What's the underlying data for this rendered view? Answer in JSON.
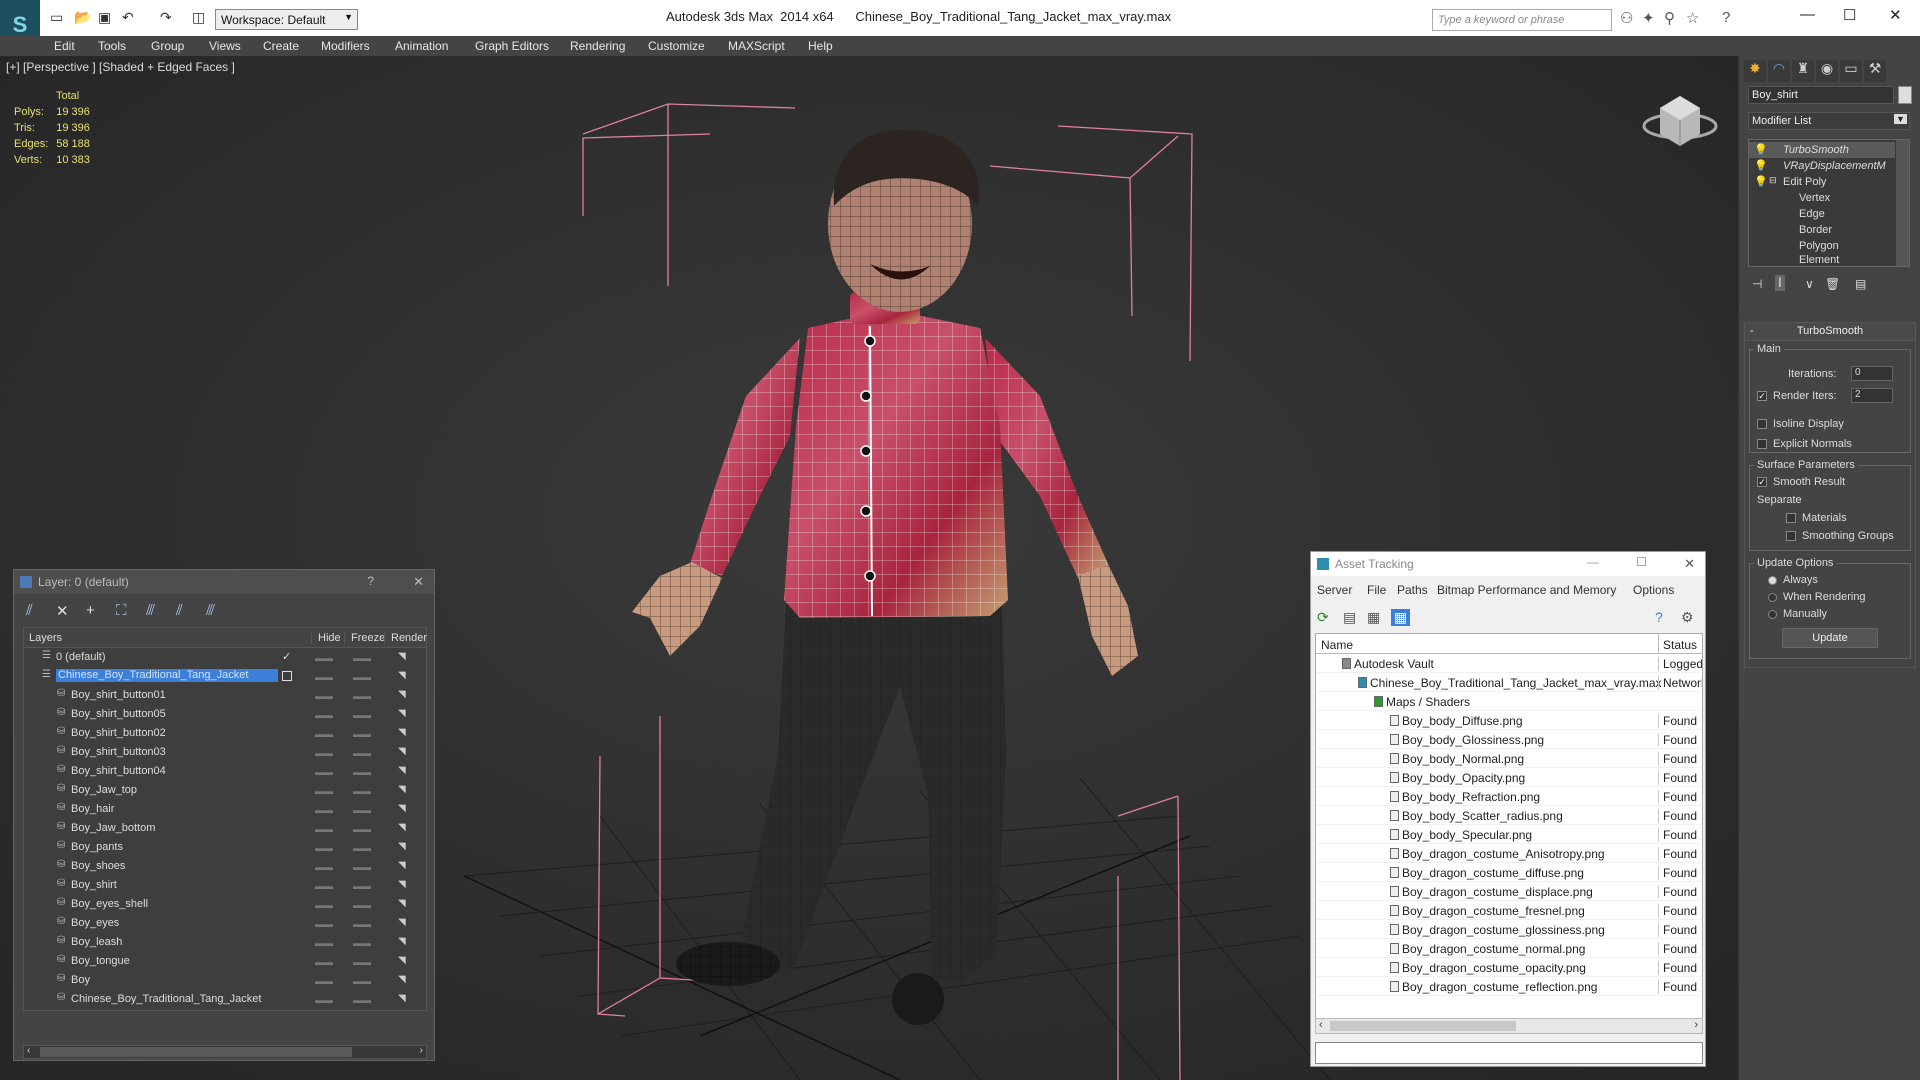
{
  "titlebar": {
    "app": "Autodesk 3ds Max  2014 x64",
    "file": "Chinese_Boy_Traditional_Tang_Jacket_max_vray.max",
    "workspace": "Workspace: Default",
    "search_placeholder": "Type a keyword or phrase"
  },
  "menu": [
    "Edit",
    "Tools",
    "Group",
    "Views",
    "Create",
    "Modifiers",
    "Animation",
    "Graph Editors",
    "Rendering",
    "Customize",
    "MAXScript",
    "Help"
  ],
  "viewport": {
    "label": "[+] [Perspective ] [Shaded + Edged Faces ]",
    "stats": {
      "header": "Total",
      "rows": [
        {
          "k": "Polys:",
          "v": "19 396"
        },
        {
          "k": "Tris:",
          "v": "19 396"
        },
        {
          "k": "Edges:",
          "v": "58 188"
        },
        {
          "k": "Verts:",
          "v": "10 383"
        }
      ]
    }
  },
  "command_panel": {
    "object_name": "Boy_shirt",
    "modifier_list": "Modifier List",
    "stack": [
      "TurboSmooth",
      "VRayDisplacementM",
      "Edit Poly",
      "Vertex",
      "Edge",
      "Border",
      "Polygon",
      "Element"
    ],
    "rollout_title": "TurboSmooth",
    "main_group": "Main",
    "iterations_label": "Iterations:",
    "iterations_value": "0",
    "render_iters_label": "Render Iters:",
    "render_iters_value": "2",
    "render_iters_checked": true,
    "isoline": "Isoline Display",
    "explicit_normals": "Explicit Normals",
    "surface_group": "Surface Parameters",
    "smooth_result": "Smooth Result",
    "smooth_result_checked": true,
    "separate": "Separate",
    "materials": "Materials",
    "smoothing_groups": "Smoothing Groups",
    "update_group": "Update Options",
    "always": "Always",
    "when_rendering": "When Rendering",
    "manually": "Manually",
    "update_button": "Update"
  },
  "layers": {
    "title": "Layer: 0 (default)",
    "help": "?",
    "columns": {
      "layers": "Layers",
      "hide": "Hide",
      "freeze": "Freeze",
      "render": "Render"
    },
    "rows": [
      {
        "name": "0 (default)",
        "level": 0
      },
      {
        "name": "Chinese_Boy_Traditional_Tang_Jacket",
        "level": 0,
        "selected": true
      },
      {
        "name": "Boy_shirt_button01",
        "level": 1
      },
      {
        "name": "Boy_shirt_button05",
        "level": 1
      },
      {
        "name": "Boy_shirt_button02",
        "level": 1
      },
      {
        "name": "Boy_shirt_button03",
        "level": 1
      },
      {
        "name": "Boy_shirt_button04",
        "level": 1
      },
      {
        "name": "Boy_Jaw_top",
        "level": 1
      },
      {
        "name": "Boy_hair",
        "level": 1
      },
      {
        "name": "Boy_Jaw_bottom",
        "level": 1
      },
      {
        "name": "Boy_pants",
        "level": 1
      },
      {
        "name": "Boy_shoes",
        "level": 1
      },
      {
        "name": "Boy_shirt",
        "level": 1
      },
      {
        "name": "Boy_eyes_shell",
        "level": 1
      },
      {
        "name": "Boy_eyes",
        "level": 1
      },
      {
        "name": "Boy_leash",
        "level": 1
      },
      {
        "name": "Boy_tongue",
        "level": 1
      },
      {
        "name": "Boy",
        "level": 1
      },
      {
        "name": "Chinese_Boy_Traditional_Tang_Jacket",
        "level": 1
      }
    ]
  },
  "asset_tracking": {
    "title": "Asset Tracking",
    "menu": [
      "Server",
      "File",
      "Paths",
      "Bitmap Performance and Memory",
      "Options"
    ],
    "columns": {
      "name": "Name",
      "status": "Status"
    },
    "rows": [
      {
        "name": "Autodesk Vault",
        "status": "Logged Out",
        "indent": 1
      },
      {
        "name": "Chinese_Boy_Traditional_Tang_Jacket_max_vray.max",
        "status": "Network",
        "indent": 2
      },
      {
        "name": "Maps / Shaders",
        "status": "",
        "indent": 3
      },
      {
        "name": "Boy_body_Diffuse.png",
        "status": "Found",
        "indent": 4
      },
      {
        "name": "Boy_body_Glossiness.png",
        "status": "Found",
        "indent": 4
      },
      {
        "name": "Boy_body_Normal.png",
        "status": "Found",
        "indent": 4
      },
      {
        "name": "Boy_body_Opacity.png",
        "status": "Found",
        "indent": 4
      },
      {
        "name": "Boy_body_Refraction.png",
        "status": "Found",
        "indent": 4
      },
      {
        "name": "Boy_body_Scatter_radius.png",
        "status": "Found",
        "indent": 4
      },
      {
        "name": "Boy_body_Specular.png",
        "status": "Found",
        "indent": 4
      },
      {
        "name": "Boy_dragon_costume_Anisotropy.png",
        "status": "Found",
        "indent": 4
      },
      {
        "name": "Boy_dragon_costume_diffuse.png",
        "status": "Found",
        "indent": 4
      },
      {
        "name": "Boy_dragon_costume_displace.png",
        "status": "Found",
        "indent": 4
      },
      {
        "name": "Boy_dragon_costume_fresnel.png",
        "status": "Found",
        "indent": 4
      },
      {
        "name": "Boy_dragon_costume_glossiness.png",
        "status": "Found",
        "indent": 4
      },
      {
        "name": "Boy_dragon_costume_normal.png",
        "status": "Found",
        "indent": 4
      },
      {
        "name": "Boy_dragon_costume_opacity.png",
        "status": "Found",
        "indent": 4
      },
      {
        "name": "Boy_dragon_costume_reflection.png",
        "status": "Found",
        "indent": 4
      }
    ]
  },
  "colors": {
    "accent": "#3c7fd8",
    "stats": "#e6e070",
    "bbox": "#e0809a"
  }
}
